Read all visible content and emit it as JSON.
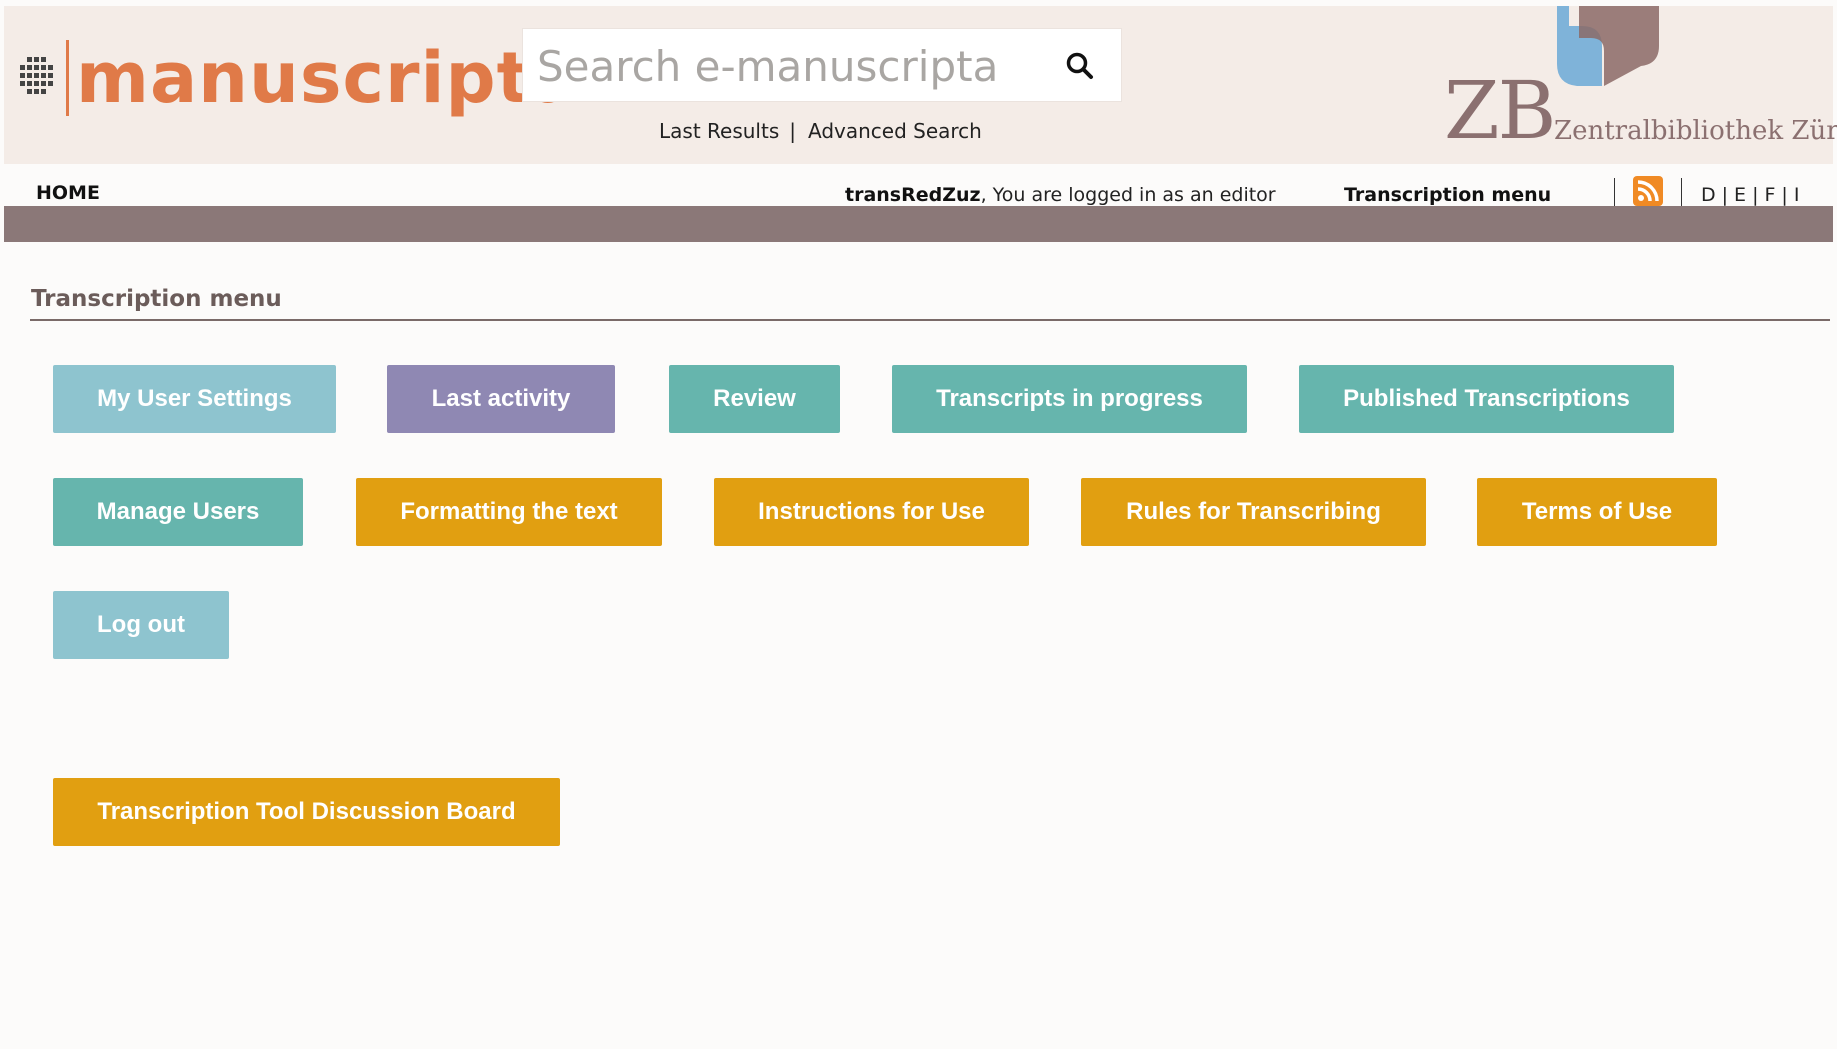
{
  "header": {
    "logo_text": "manuscripta",
    "search": {
      "placeholder": "Search e-manuscripta",
      "value": ""
    },
    "links": {
      "last_results": "Last Results",
      "separator": "|",
      "advanced_search": "Advanced Search"
    },
    "library": {
      "letters": "ZB",
      "name": "Zentralbibliothek Zürich"
    }
  },
  "nav": {
    "home": "HOME",
    "username": "transRedZuz",
    "login_text": ", You are logged in as an editor",
    "transcription_menu": "Transcription menu",
    "languages": [
      "D",
      "E",
      "F",
      "I"
    ]
  },
  "main": {
    "section_title": "Transcription menu",
    "buttons": {
      "my_user_settings": "My User Settings",
      "last_activity": "Last activity",
      "review": "Review",
      "transcripts_in_progress": "Transcripts in progress",
      "published_transcriptions": "Published Transcriptions",
      "manage_users": "Manage Users",
      "formatting_the_text": "Formatting the text",
      "instructions_for_use": "Instructions for Use",
      "rules_for_transcribing": "Rules for Transcribing",
      "terms_of_use": "Terms of Use",
      "log_out": "Log out",
      "discussion_board": "Transcription Tool Discussion Board"
    }
  },
  "colors": {
    "brand_orange": "#e07a48",
    "header_bg": "#f4ece7",
    "bar_brown": "#8b7878",
    "button_light_blue": "#8ec4cf",
    "button_purple": "#8f88b3",
    "button_teal": "#66b5ad",
    "button_orange": "#e19f11",
    "rss_orange": "#f08a24"
  },
  "icons": {
    "search": "search-icon",
    "rss": "rss-icon",
    "logo": "manuscripta-logo-icon",
    "library_logo": "zb-logo-icon"
  }
}
